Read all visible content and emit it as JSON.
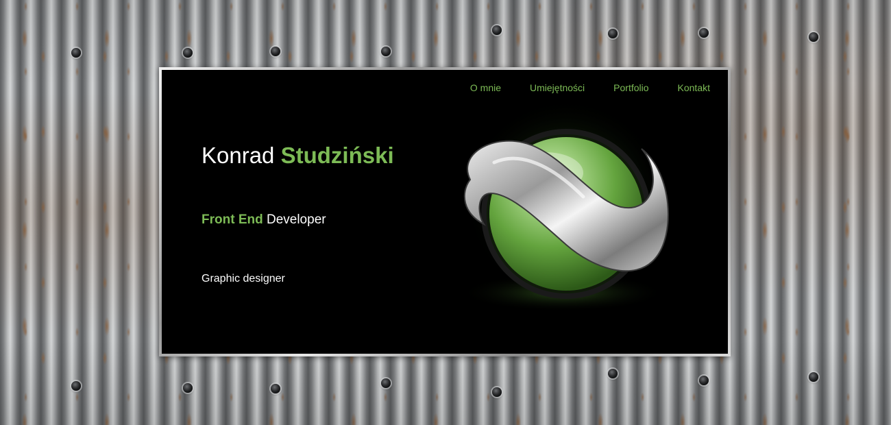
{
  "nav": {
    "items": [
      {
        "label": "O mnie"
      },
      {
        "label": "Umiejętności"
      },
      {
        "label": "Portfolio"
      },
      {
        "label": "Kontakt"
      }
    ]
  },
  "hero": {
    "first_name": "Konrad",
    "last_name": "Studziński",
    "role_accent": "Front End",
    "role_rest": "Developer",
    "subrole": "Graphic designer"
  },
  "colors": {
    "accent": "#7dbb56",
    "screen_bg": "#000000",
    "text": "#ffffff"
  },
  "icons": {
    "logo": "green-sphere-silver-ring-logo"
  }
}
